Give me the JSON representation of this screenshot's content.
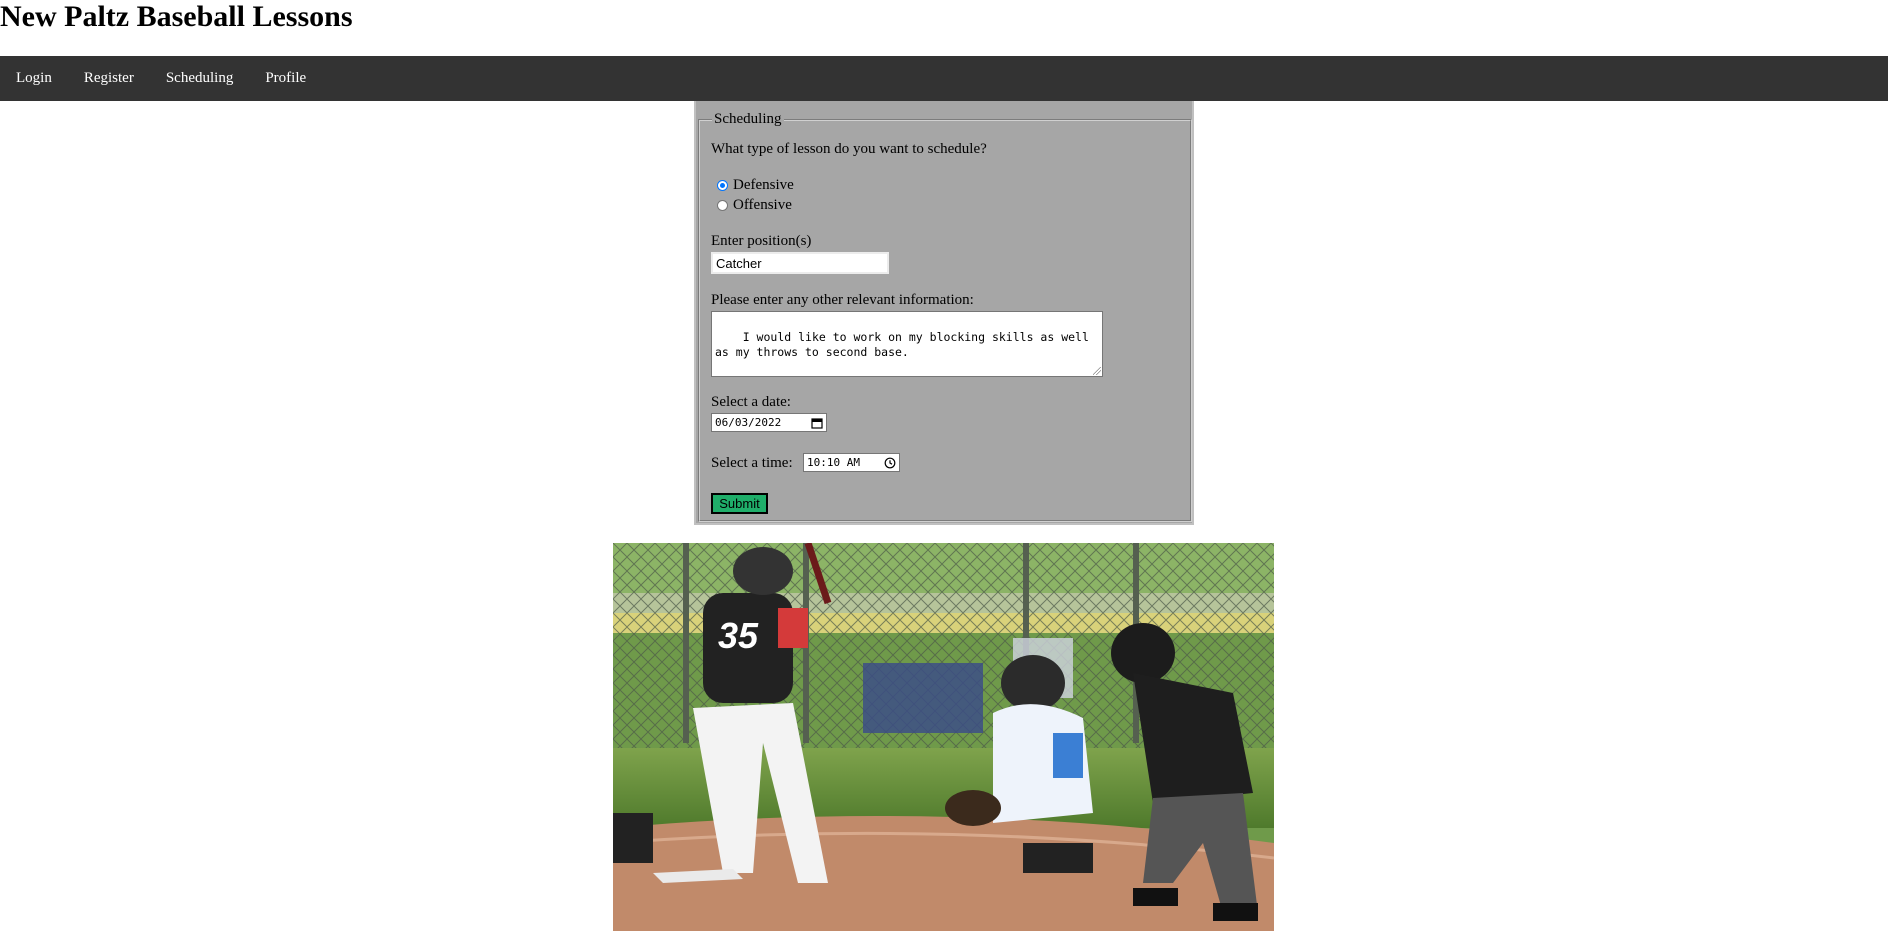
{
  "site": {
    "title": "New Paltz Baseball Lessons"
  },
  "nav": {
    "items": [
      {
        "label": "Login"
      },
      {
        "label": "Register"
      },
      {
        "label": "Scheduling"
      },
      {
        "label": "Profile"
      }
    ]
  },
  "form": {
    "legend": "Scheduling",
    "lesson_question": "What type of lesson do you want to schedule?",
    "lesson_options": [
      {
        "label": "Defensive",
        "checked": true
      },
      {
        "label": "Offensive",
        "checked": false
      }
    ],
    "position_label": "Enter position(s)",
    "position_value": "Catcher",
    "info_label": "Please enter any other relevant information:",
    "info_value": "I would like to work on my blocking skills as well\nas my throws to second base.",
    "date_label": "Select a date:",
    "date_value": "06/03/2022",
    "time_label": "Select a time:",
    "time_value": "10:10 AM",
    "submit_label": "Submit",
    "submit_color": "#1fae6a"
  },
  "colors": {
    "navbar": "#333333",
    "form_background": "#a6a6a6",
    "radio_accent": "#0075ff"
  },
  "icons": {
    "date": "calendar-icon",
    "time": "clock-icon"
  }
}
